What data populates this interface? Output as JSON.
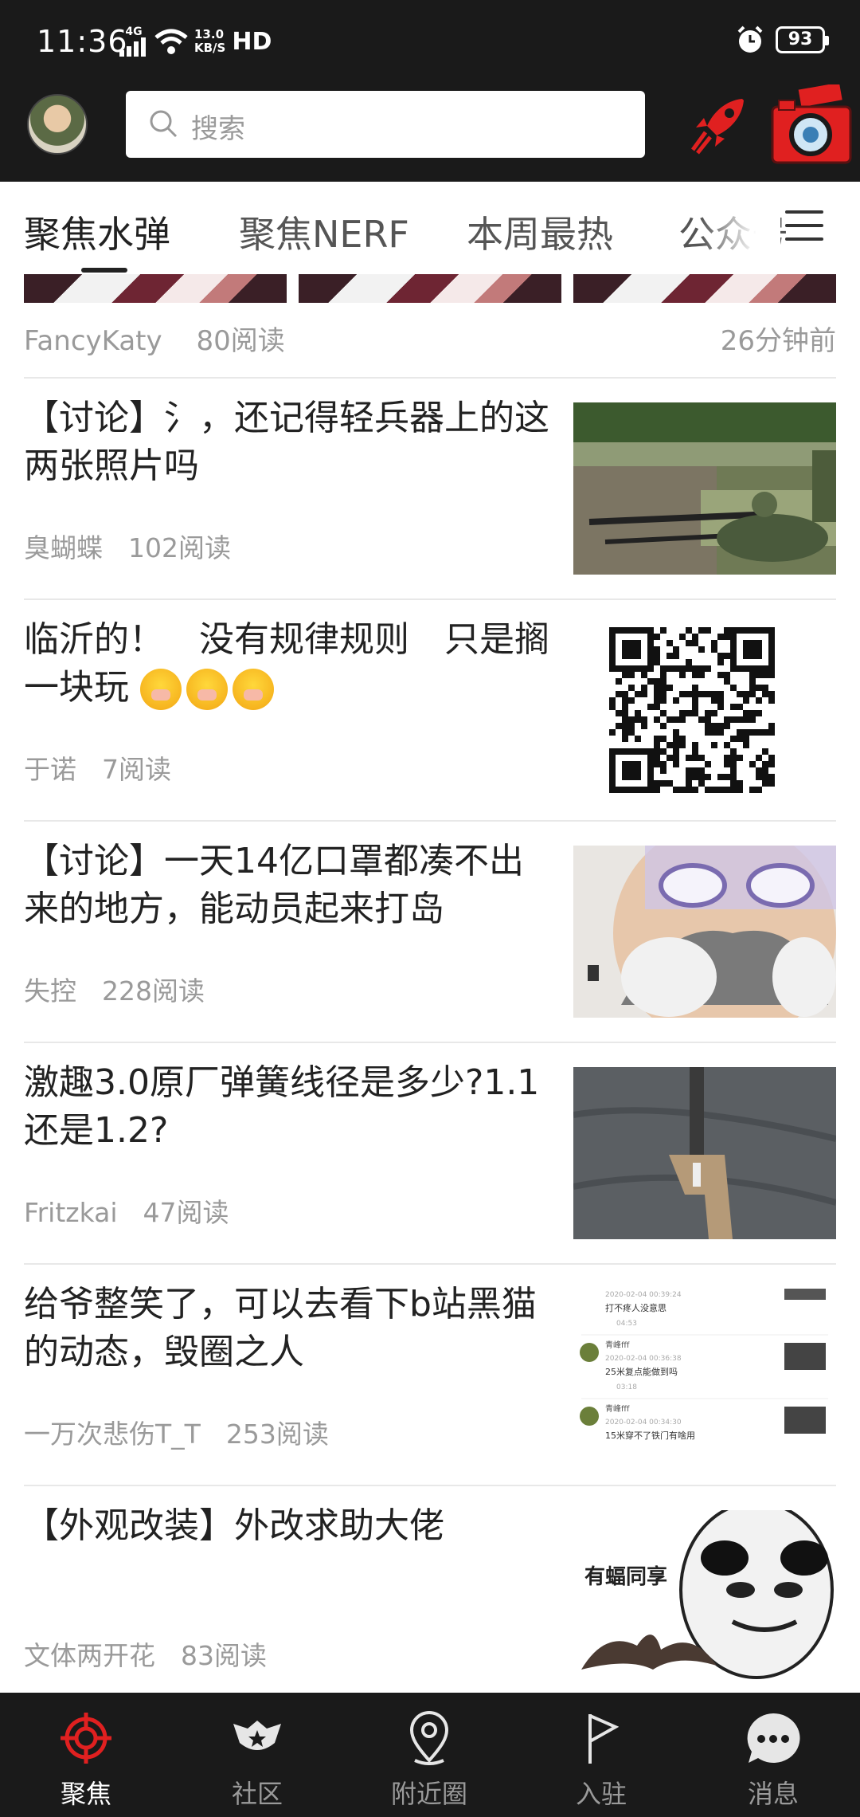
{
  "status_bar": {
    "time": "11:36",
    "network": "4G",
    "speed_value": "13.0",
    "speed_unit": "KB/S",
    "hd": "HD",
    "battery": "93"
  },
  "header": {
    "search_placeholder": "搜索"
  },
  "tabs": [
    "聚焦水弹",
    "聚焦NERF",
    "本周最热",
    "公众号"
  ],
  "active_tab": 0,
  "feed": {
    "partial_item": {
      "author": "FancyKaty",
      "reads": "80阅读",
      "time": "26分钟前"
    },
    "items": [
      {
        "title": "【讨论】氵，还记得轻兵器上的这两张照片吗",
        "author": "臭蝴蝶",
        "reads": "102阅读",
        "thumb": "sniper-photo"
      },
      {
        "title": "临沂的！　没有规律规则　只是搁一块玩",
        "author": "于诺",
        "reads": "7阅读",
        "thumb": "qr-code"
      },
      {
        "title": "【讨论】一天14亿口罩都凑不出来的地方，能动员起来打岛",
        "author": "失控",
        "reads": "228阅读",
        "thumb": "gas-mask-photo"
      },
      {
        "title": "激趣3.0原厂弹簧线径是多少?1.1还是1.2?",
        "author": "Fritzkai",
        "reads": "47阅读",
        "thumb": "blaster-photo"
      },
      {
        "title": "给爷整笑了，可以去看下b站黑猫的动态，毁圈之人",
        "author": "一万次悲伤T_T",
        "reads": "253阅读",
        "thumb": "comments-screenshot",
        "thumb_text": {
          "c1_time": "2020-02-04 00:39:24",
          "c1_text": "打不疼人没意思",
          "c1_dur": "04:53",
          "c2_user": "青峰fff",
          "c2_time": "2020-02-04 00:36:38",
          "c2_text": "25米复点能做到吗",
          "c2_dur": "03:18",
          "c3_user": "青峰fff",
          "c3_time": "2020-02-04 00:34:30",
          "c3_text": "15米穿不了铁门有啥用"
        }
      },
      {
        "title": "【外观改装】外改求助大佬",
        "author": "文体两开花",
        "reads": "83阅读",
        "thumb": "meme-bat",
        "thumb_text": "有蝠同享"
      }
    ]
  },
  "bottom_nav": {
    "items": [
      {
        "label": "聚焦",
        "icon": "crosshair-icon",
        "active": true
      },
      {
        "label": "社区",
        "icon": "badge-icon",
        "active": false
      },
      {
        "label": "附近圈",
        "icon": "location-pin-icon",
        "active": false
      },
      {
        "label": "入驻",
        "icon": "flag-icon",
        "active": false
      },
      {
        "label": "消息",
        "icon": "chat-bubble-icon",
        "active": false
      }
    ],
    "accent": "#e02020"
  }
}
